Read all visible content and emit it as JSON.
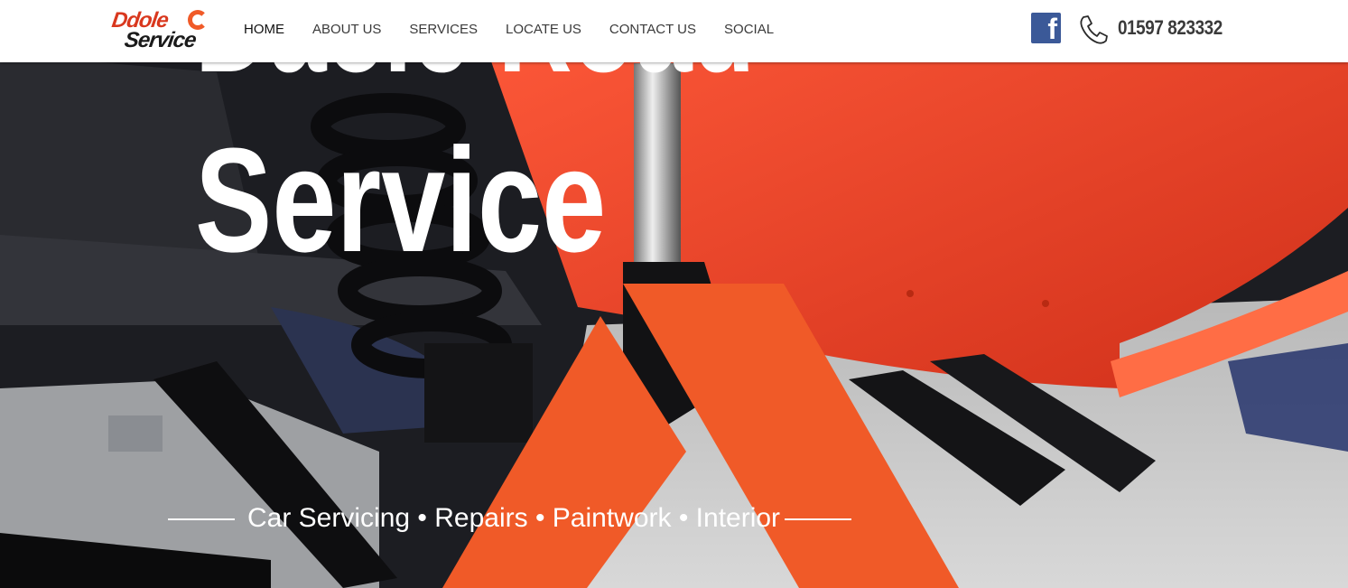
{
  "logo": {
    "line1": "Ddole",
    "line2": "Service"
  },
  "nav": {
    "items": [
      {
        "label": "HOME",
        "active": true
      },
      {
        "label": "ABOUT US"
      },
      {
        "label": "SERVICES"
      },
      {
        "label": "LOCATE US"
      },
      {
        "label": "CONTACT US"
      },
      {
        "label": "SOCIAL"
      }
    ]
  },
  "header": {
    "facebook_icon": "facebook-icon",
    "phone_icon": "phone-icon",
    "phone_number": "01597 823332"
  },
  "hero": {
    "title_line1": "Dacie Road",
    "title_line2": "Service",
    "tagline": "Car Servicing • Repairs • Paintwork • Interior"
  },
  "colors": {
    "accent_orange": "#f05a28",
    "car_red": "#e8401f",
    "facebook_blue": "#3b5998"
  }
}
